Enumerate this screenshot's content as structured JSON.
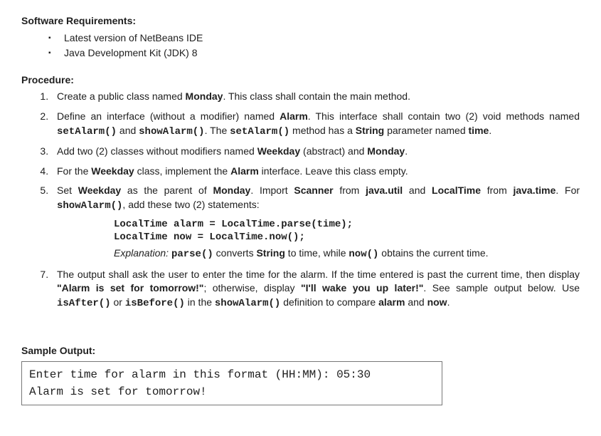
{
  "software_title": "Software Requirements:",
  "software_items": [
    "Latest version of NetBeans IDE",
    "Java Development Kit (JDK) 8"
  ],
  "procedure_title": "Procedure:",
  "steps": {
    "step1": {
      "pre": "Create a public class named ",
      "b1": "Monday",
      "post": ". This class shall contain the main method."
    },
    "step2": {
      "pre": "Define an interface (without a modifier) named ",
      "b1": "Alarm",
      "mid1": ". This interface shall contain two (2) void methods named ",
      "c1": "setAlarm()",
      "and": " and ",
      "c2": "showAlarm()",
      "mid2": ". The ",
      "c3": "setAlarm()",
      "mid3": " method has a ",
      "b2": "String",
      "mid4": " parameter named ",
      "b3": "time",
      "end": "."
    },
    "step3": {
      "pre": "Add two (2) classes without modifiers named ",
      "b1": "Weekday",
      "mid1": " (abstract) and ",
      "b2": "Monday",
      "end": "."
    },
    "step4": {
      "pre": "For the ",
      "b1": "Weekday",
      "mid1": " class, implement the ",
      "b2": "Alarm",
      "end": " interface. Leave this class empty."
    },
    "step5": {
      "pre": "Set ",
      "b1": "Weekday",
      "mid1": " as the parent of ",
      "b2": "Monday",
      "mid2": ". Import ",
      "b3": "Scanner",
      "mid3": " from ",
      "b4": "java.util",
      "mid4": " and ",
      "b5": "LocalTime",
      "mid5": " from ",
      "b6": "java.time",
      "mid6": ". For ",
      "c1": "showAlarm()",
      "end": ", add these two (2) statements:"
    },
    "code_line1": "LocalTime alarm = LocalTime.parse(time);",
    "code_line2": "LocalTime now = LocalTime.now();",
    "explanation": {
      "label": "Explanation: ",
      "c1": "parse()",
      "t1": " converts ",
      "b1": "String",
      "t2": " to time, while ",
      "c2": "now()",
      "t3": " obtains the current time."
    },
    "step7": {
      "pre": "The output shall ask the user to enter the time for the alarm. If the time entered is past the current time, then display ",
      "b1": "\"Alarm is set for tomorrow!\"",
      "mid1": "; otherwise, display ",
      "b2": "\"I'll wake you up later!\"",
      "mid2": ". See sample output below. Use ",
      "c1": "isAfter()",
      "or": " or ",
      "c2": "isBefore()",
      "mid3": " in the ",
      "c3": "showAlarm()",
      "mid4": " definition to compare ",
      "b3": "alarm",
      "and": " and ",
      "b4": "now",
      "end": "."
    }
  },
  "sample_title": "Sample Output:",
  "sample_line1": "Enter time for alarm in this format (HH:MM): 05:30",
  "sample_line2": "Alarm is set for tomorrow!"
}
